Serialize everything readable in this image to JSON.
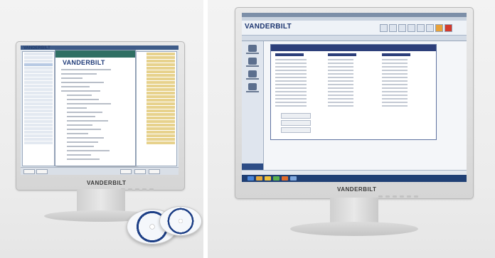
{
  "photos": [
    {
      "brand": "VANDERBILT",
      "screen_logo": "VANDERBILT",
      "list_logo": "VANDERBILT"
    },
    {
      "brand": "VANDERBILT",
      "screen_logo": "VANDERBILT"
    }
  ]
}
